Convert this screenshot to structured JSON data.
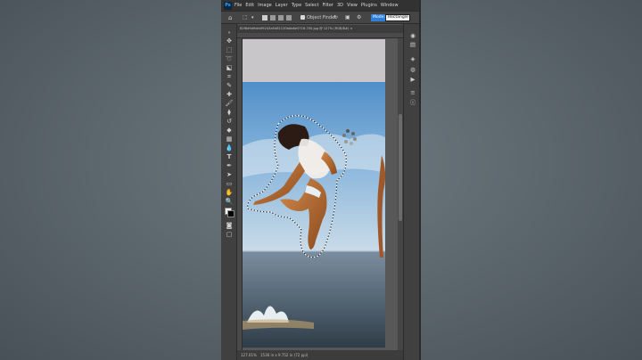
{
  "menubar": {
    "logo": "Ps",
    "items": [
      "File",
      "Edit",
      "Image",
      "Layer",
      "Type",
      "Select",
      "Filter",
      "3D",
      "View",
      "Plugins",
      "Window"
    ]
  },
  "options": {
    "object_finder": "Object Finder",
    "mode_label": "Mode:",
    "mode_value": "Rectangle"
  },
  "document": {
    "tab_title": "82f6d9d9de0f9243a5481120bbb6e5716-700.jpg @ 127% (RGB/8#) ×"
  },
  "status": {
    "zoom": "127.01%",
    "doc_info": "1536 in x 9.752 in (72 ppi)"
  },
  "tools": [
    "move-icon",
    "marquee-icon",
    "lasso-icon",
    "object-select-icon",
    "eyedropper-icon",
    "brush-icon",
    "stamp-icon",
    "history-brush-icon",
    "eraser-icon",
    "gradient-icon",
    "blur-icon",
    "type-icon",
    "pen-icon",
    "path-select-icon",
    "rectangle-icon",
    "hand-icon",
    "zoom-icon"
  ],
  "colors": {
    "ui_dark": "#323232",
    "ui_panel": "#535353",
    "accent": "#2f7fd6"
  }
}
